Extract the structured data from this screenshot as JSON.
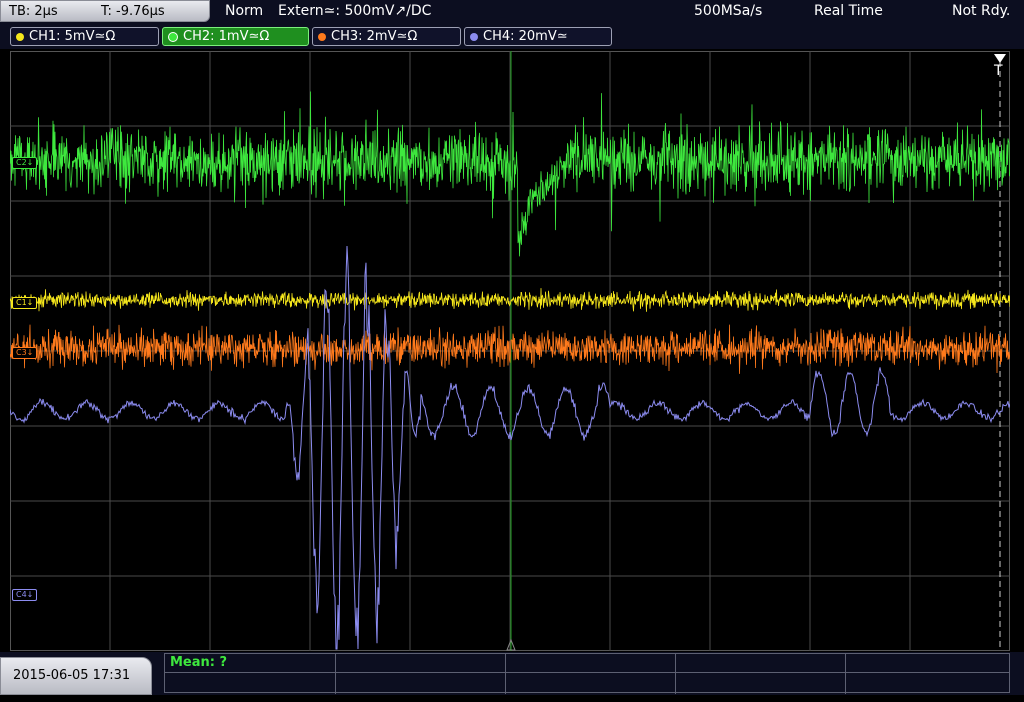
{
  "top": {
    "timebase": "TB: 2µs",
    "trigger_time": "T: -9.76µs",
    "trigger_mode": "Norm",
    "trigger_source": "Extern≃: 500mV↗/DC",
    "sample_rate": "500MSa/s",
    "acq_mode": "Real Time",
    "status": "Not Rdy."
  },
  "channels": [
    {
      "label": "CH1: 5mV≃Ω",
      "color": "#f5e61c",
      "active": false
    },
    {
      "label": "CH2: 1mV≃Ω",
      "color": "#3ee83e",
      "active": true
    },
    {
      "label": "CH3: 2mV≃Ω",
      "color": "#ff7a1c",
      "active": false
    },
    {
      "label": "CH4: 20mV≃",
      "color": "#8c8cf0",
      "active": false
    }
  ],
  "markers": {
    "ch2": "C2↓",
    "ch1": "C1↓",
    "ch3": "C3↓",
    "ch4": "C4↓"
  },
  "bottom": {
    "datetime": "2015-06-05 17:31",
    "measurement": "Mean: ?"
  },
  "colors": {
    "ch1": "#f5e61c",
    "ch2": "#3ee83e",
    "ch3": "#ff7a1c",
    "ch4": "#8c8cf0",
    "grid": "#4a4a4a",
    "trigger_line": "#1e9e1e"
  }
}
